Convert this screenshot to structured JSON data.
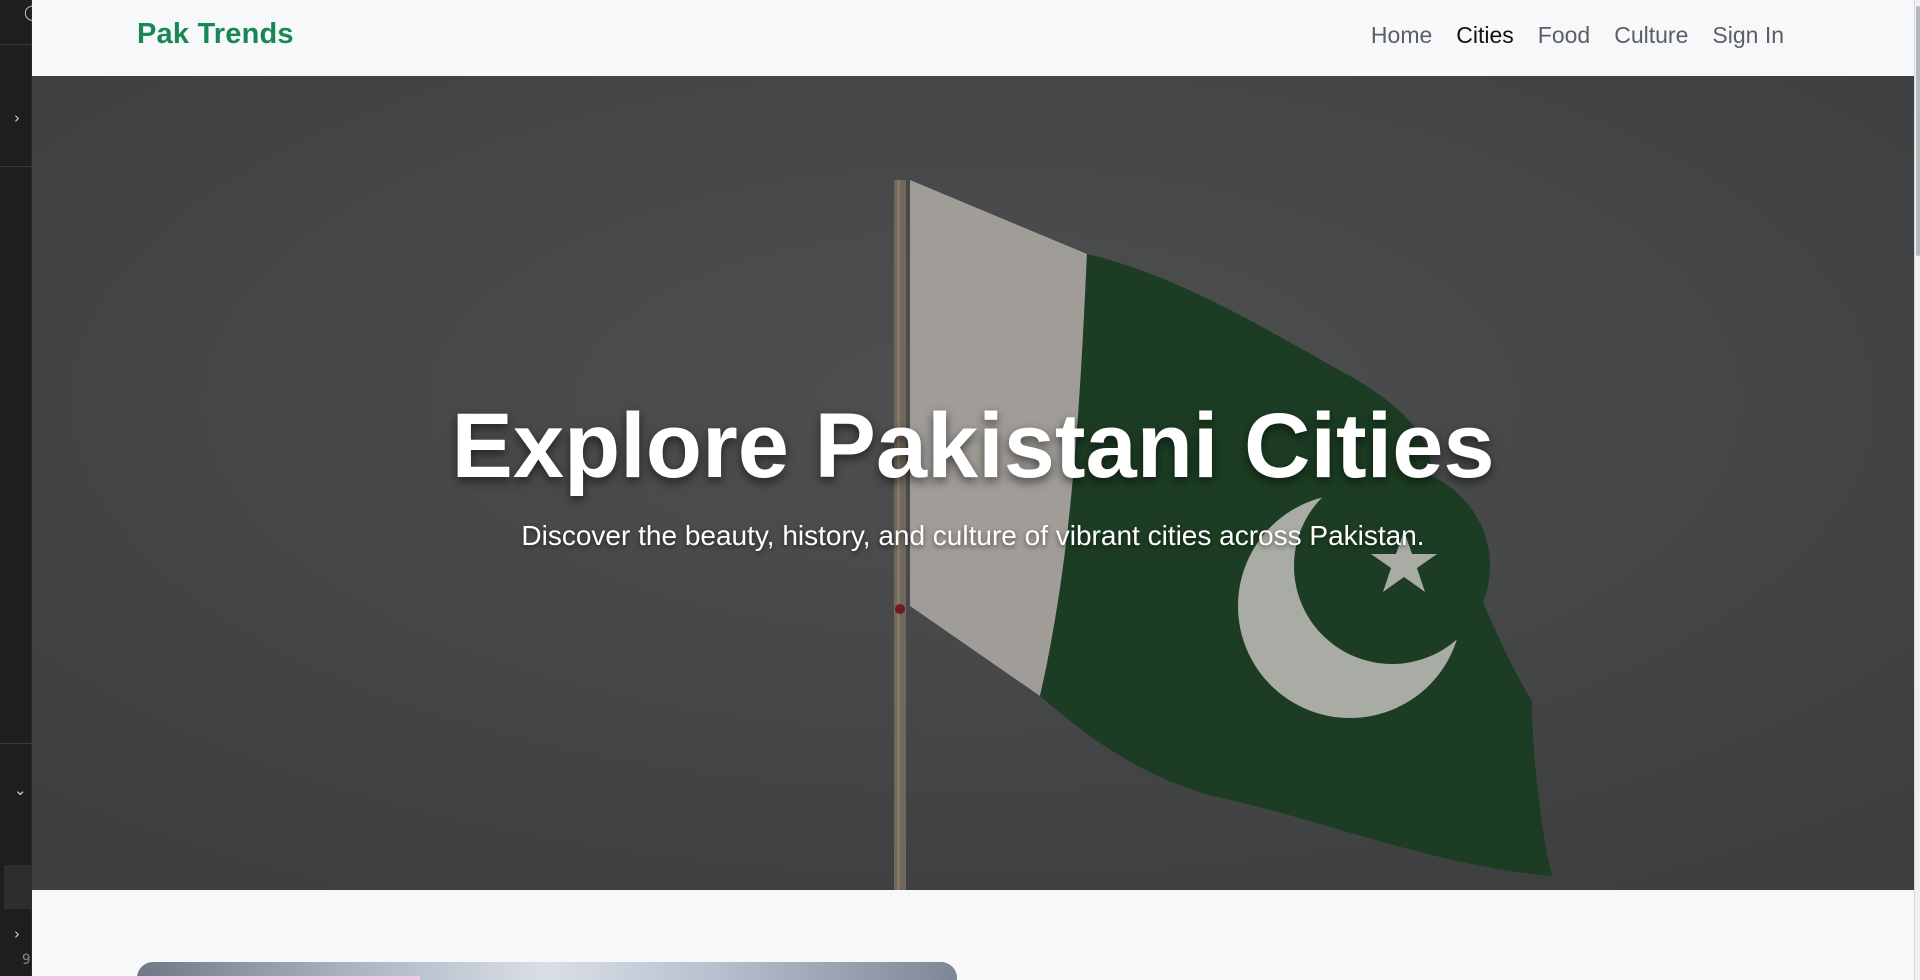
{
  "nav": {
    "brand": "Pak Trends",
    "links": [
      {
        "label": "Home",
        "active": false
      },
      {
        "label": "Cities",
        "active": true
      },
      {
        "label": "Food",
        "active": false
      },
      {
        "label": "Culture",
        "active": false
      },
      {
        "label": "Sign In",
        "active": false
      }
    ]
  },
  "hero": {
    "title": "Explore Pakistani Cities",
    "subtitle": "Discover the beauty, history, and culture of vibrant cities across Pakistan.",
    "image": "pakistan-flag-photo"
  },
  "editor": {
    "gutter_number": "9"
  },
  "colors": {
    "brand": "#198754",
    "flag_green": "#1f4a2b",
    "flag_white": "#e8e4de"
  }
}
